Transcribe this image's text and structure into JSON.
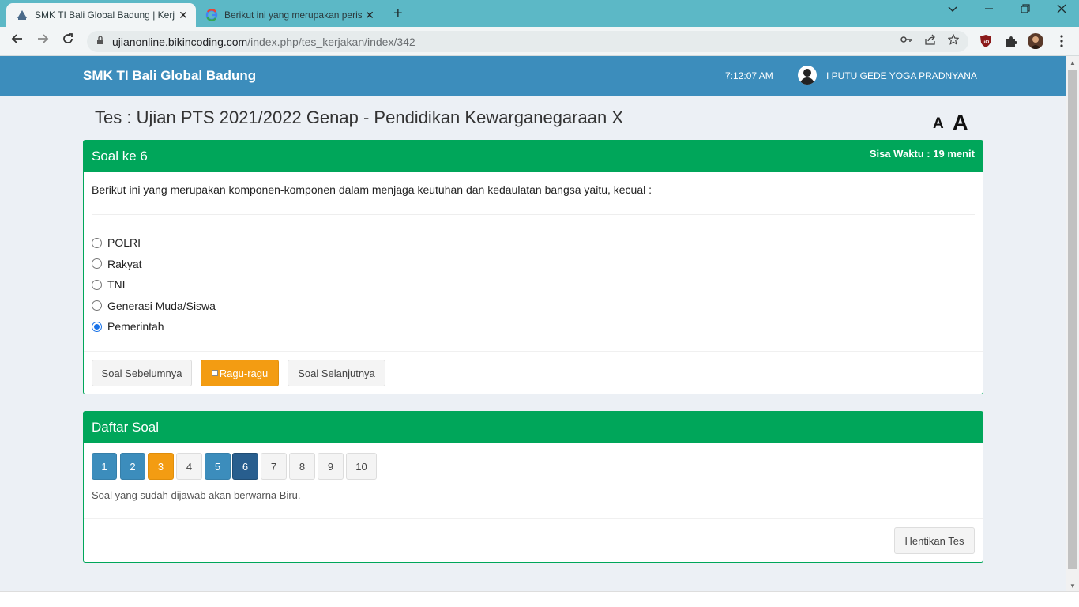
{
  "browser": {
    "tabs": [
      {
        "title": "SMK TI Bali Global Badung | Kerja",
        "active": true
      },
      {
        "title": "Berikut ini yang merupakan peris",
        "active": false
      }
    ],
    "url_host": "ujianonline.bikincoding.com",
    "url_path": "/index.php/tes_kerjakan/index/342",
    "new_tab_symbol": "+",
    "close_symbol": "✕"
  },
  "header": {
    "brand": "SMK TI Bali Global Badung",
    "time": "7:12:07 AM",
    "user_name": "I PUTU GEDE YOGA PRADNYANA"
  },
  "page": {
    "test_title": "Tes : Ujian PTS 2021/2022 Genap - Pendidikan Kewarganegaraan X",
    "font_small": "A",
    "font_large": "A"
  },
  "question_box": {
    "title": "Soal ke 6",
    "timer": "Sisa Waktu : 19 menit",
    "question": "Berikut ini yang merupakan komponen-komponen dalam menjaga keutuhan dan kedaulatan bangsa yaitu, kecual :",
    "options": [
      {
        "label": "POLRI",
        "selected": false
      },
      {
        "label": "Rakyat",
        "selected": false
      },
      {
        "label": "TNI",
        "selected": false
      },
      {
        "label": "Generasi Muda/Siswa",
        "selected": false
      },
      {
        "label": "Pemerintah",
        "selected": true
      }
    ],
    "prev_label": "Soal Sebelumnya",
    "doubt_label": "Ragu-ragu",
    "next_label": "Soal Selanjutnya"
  },
  "list_box": {
    "title": "Daftar Soal",
    "numbers": [
      {
        "n": "1",
        "state": "answered"
      },
      {
        "n": "2",
        "state": "answered"
      },
      {
        "n": "3",
        "state": "doubt"
      },
      {
        "n": "4",
        "state": "empty"
      },
      {
        "n": "5",
        "state": "answered"
      },
      {
        "n": "6",
        "state": "current"
      },
      {
        "n": "7",
        "state": "empty"
      },
      {
        "n": "8",
        "state": "empty"
      },
      {
        "n": "9",
        "state": "empty"
      },
      {
        "n": "10",
        "state": "empty"
      }
    ],
    "hint": "Soal yang sudah dijawab akan berwarna Biru.",
    "stop_label": "Hentikan Tes"
  },
  "colors": {
    "header_blue": "#3c8dbc",
    "box_green": "#00a65a",
    "warning_orange": "#f39c12",
    "current_dark_blue": "#285e8e",
    "browser_teal": "#5cb8c6"
  }
}
